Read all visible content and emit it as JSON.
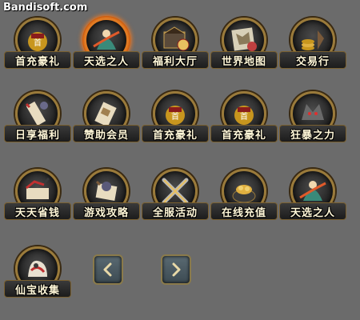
{
  "watermark": "Bandisoft.com",
  "colors": {
    "background": "#6b6b6b",
    "gold_border": "#9a7a3a",
    "active_glow": "#ff7a1a",
    "label_text": "#fff7d8"
  },
  "icons": [
    {
      "label": "首充豪礼",
      "icon": "first-recharge-icon",
      "active": false
    },
    {
      "label": "天选之人",
      "icon": "chosen-one-icon",
      "active": true
    },
    {
      "label": "福利大厅",
      "icon": "welfare-hall-icon",
      "active": false
    },
    {
      "label": "世界地图",
      "icon": "world-map-icon",
      "active": false
    },
    {
      "label": "交易行",
      "icon": "trading-house-icon",
      "active": false
    },
    {
      "label": "日享福利",
      "icon": "daily-welfare-icon",
      "active": false
    },
    {
      "label": "赞助会员",
      "icon": "sponsor-member-icon",
      "active": false
    },
    {
      "label": "首充豪礼",
      "icon": "first-recharge-icon",
      "active": false
    },
    {
      "label": "首充豪礼",
      "icon": "first-recharge-icon",
      "active": false
    },
    {
      "label": "狂暴之力",
      "icon": "berserk-power-icon",
      "active": false
    },
    {
      "label": "天天省钱",
      "icon": "daily-saving-icon",
      "active": false
    },
    {
      "label": "游戏攻略",
      "icon": "game-guide-icon",
      "active": false
    },
    {
      "label": "全服活动",
      "icon": "server-event-icon",
      "active": false
    },
    {
      "label": "在线充值",
      "icon": "online-recharge-icon",
      "active": false
    },
    {
      "label": "天选之人",
      "icon": "chosen-one-icon",
      "active": false
    },
    {
      "label": "仙宝收集",
      "icon": "treasure-collection-icon",
      "active": false
    }
  ],
  "nav": {
    "prev_icon": "chevron-left-icon",
    "next_icon": "chevron-right-icon"
  }
}
